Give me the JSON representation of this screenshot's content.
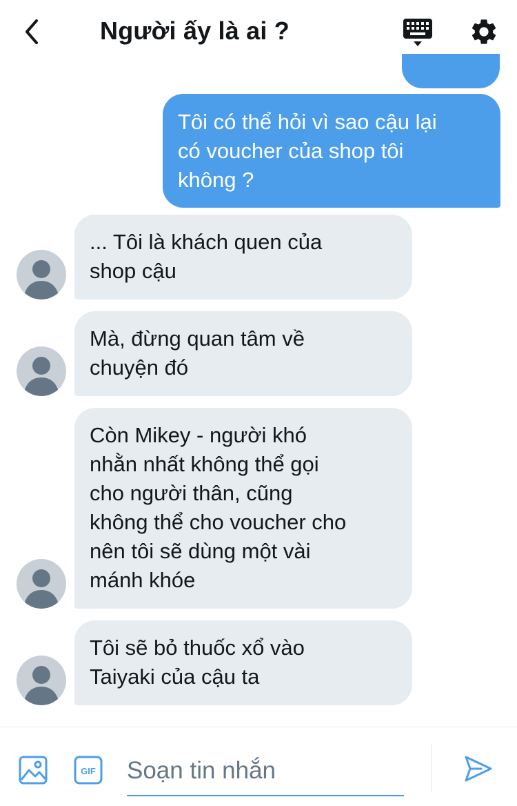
{
  "header": {
    "title": "Người ấy là ai ?",
    "icons": {
      "back": "chevron-left-icon",
      "keyboard": "keyboard-icon",
      "settings": "gear-icon"
    }
  },
  "messages": [
    {
      "side": "out",
      "text": "Tôi có thể hỏi vì sao cậu lại\ncó voucher của shop tôi\nkhông ?"
    },
    {
      "side": "in",
      "text": "... Tôi là khách quen của\nshop cậu"
    },
    {
      "side": "in",
      "text": "Mà, đừng quan tâm về\nchuyện đó"
    },
    {
      "side": "in",
      "text": "Còn Mikey - người khó\nnhằn nhất không thể gọi\ncho người thân, cũng\nkhông thể cho voucher cho\nnên tôi sẽ dùng một vài\nmánh khóe"
    },
    {
      "side": "in",
      "text": "Tôi sẽ bỏ thuốc xổ vào\nTaiyaki của cậu ta"
    }
  ],
  "compose": {
    "placeholder": "Soạn tin nhắn",
    "value": "",
    "gif_label": "GIF",
    "icons": {
      "image": "image-icon",
      "gif": "gif-icon",
      "send": "send-icon"
    }
  },
  "colors": {
    "accent": "#4c9eeb",
    "incoming_bubble": "#e6ecf0",
    "avatar": "#c8cfd6"
  }
}
